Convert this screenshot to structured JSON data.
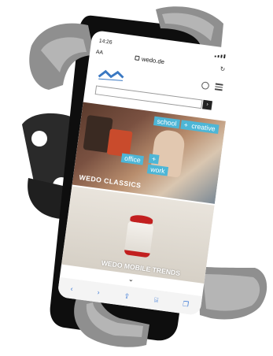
{
  "status_bar": {
    "time": "14:26"
  },
  "url_bar": {
    "text_size_label": "AA",
    "url": "wedo.de",
    "reload_glyph": "↻"
  },
  "search": {
    "button_glyph": "›"
  },
  "hero": {
    "tags": {
      "school": "school",
      "plus": "+",
      "creative": "creative",
      "office": "office",
      "work": "work"
    },
    "caption": "WEDO CLASSICS"
  },
  "hero2": {
    "caption": "WEDO MOBILE TRENDS"
  },
  "scroll": {
    "chevron_glyph": "⌄"
  },
  "toolbar": {
    "back": "‹",
    "forward": "›",
    "share": "⇪",
    "bookmarks": "⌸",
    "tabs": "❐"
  },
  "colors": {
    "mount": "#8f8f8f",
    "mount_light": "#b5b5b5",
    "clamp": "#2a2a2a",
    "phone": "#111111",
    "accent": "#4db6d6"
  }
}
